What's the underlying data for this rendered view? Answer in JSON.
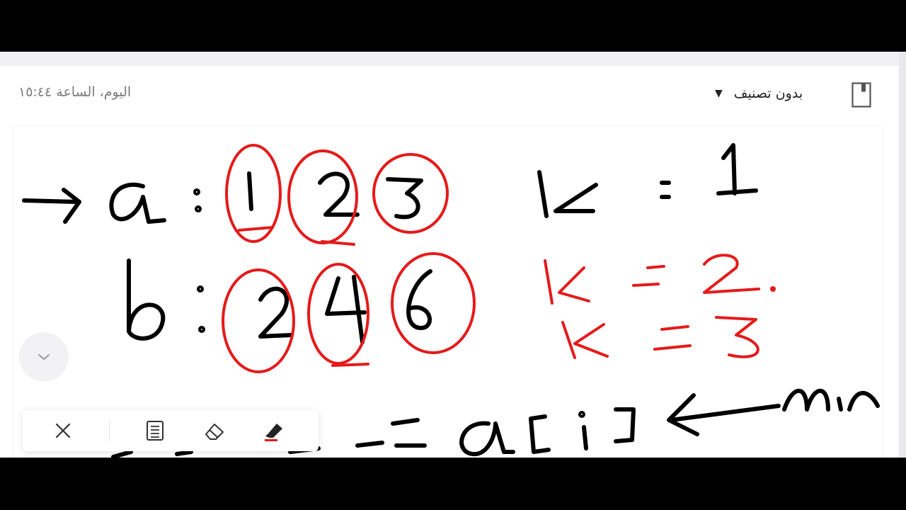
{
  "header": {
    "timestamp": "اليوم، الساعة ١٥:٤٤",
    "category_label": "بدون تصنيف",
    "category_caret": "▼"
  },
  "icons": {
    "notebook": "notebook-icon",
    "collapse": "chevron-down-icon",
    "close": "close-icon",
    "text": "document-icon",
    "eraser": "eraser-icon",
    "highlighter": "highlighter-icon"
  },
  "colors": {
    "ink_black": "#000000",
    "ink_red": "#e51a1a",
    "muted_text": "#7a7a7a",
    "toolbar_bg": "#ffffff"
  }
}
